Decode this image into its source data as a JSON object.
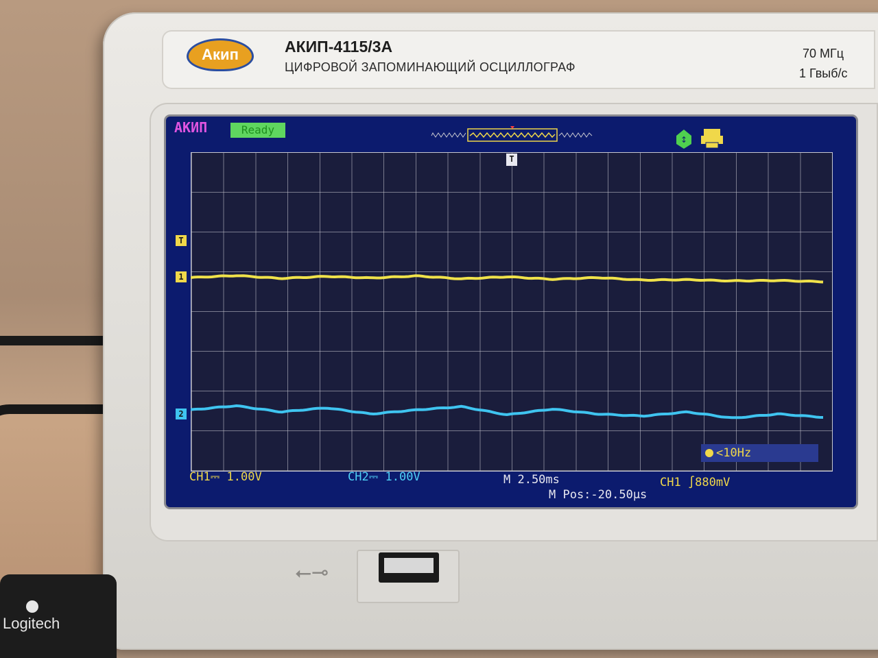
{
  "device": {
    "logo_text": "Акип",
    "model": "АКИП-4115/3А",
    "subtitle": "ЦИФРОВОЙ ЗАПОМИНАЮЩИЙ ОСЦИЛЛОГРАФ",
    "bandwidth": "70 МГц",
    "sample_rate": "1 Гвыб/с"
  },
  "screen": {
    "brand": "АКИП",
    "status": "Ready",
    "ch1_scale": "CH1⎓ 1.00V",
    "ch2_scale": "CH2⎓ 1.00V",
    "timebase": "M 2.50ms",
    "trigger": "CH1 ∫880mV",
    "position": "M Pos:-20.50µs",
    "frequency": "<10Hz",
    "trigger_marker": "T",
    "ch1_marker": "1",
    "ch2_marker": "2"
  },
  "chart_data": {
    "type": "line",
    "series": [
      {
        "name": "CH1",
        "color": "#f0e24a",
        "y_levels": [
          0.0,
          0.05,
          -0.02,
          0.03,
          -0.01,
          0.04,
          -0.03,
          0.02,
          -0.04,
          0.0,
          -0.06,
          -0.05,
          -0.08,
          -0.07,
          -0.1
        ]
      },
      {
        "name": "CH2",
        "color": "#3fc4f0",
        "y_levels": [
          0.0,
          0.1,
          -0.05,
          0.05,
          -0.1,
          0.0,
          0.08,
          -0.12,
          0.02,
          -0.1,
          -0.15,
          -0.05,
          -0.2,
          -0.1,
          -0.18
        ]
      }
    ]
  },
  "environment": {
    "logitech_text": "Logitech"
  }
}
